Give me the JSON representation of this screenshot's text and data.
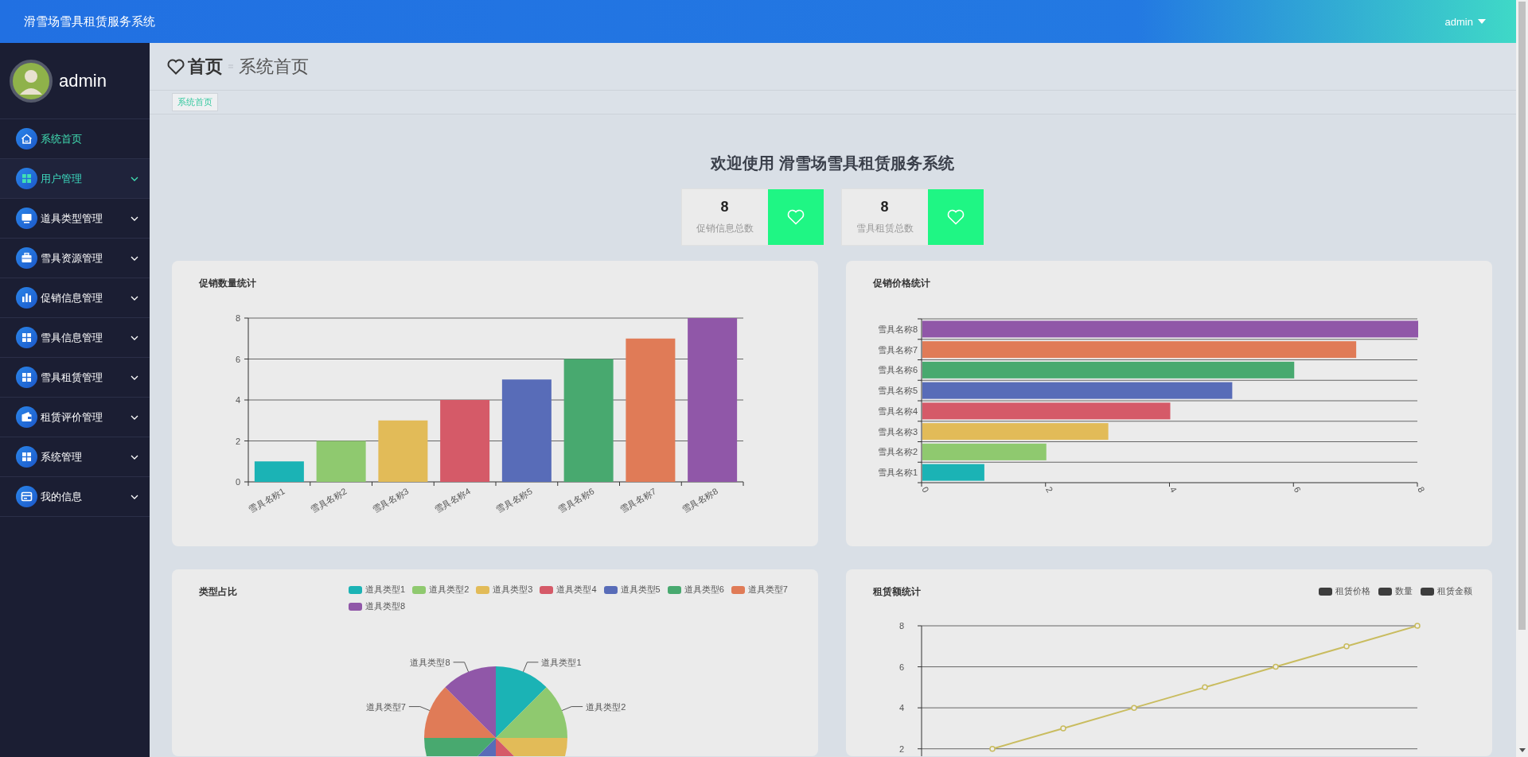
{
  "top_bar": {
    "title": "滑雪场雪具租赁服务系统",
    "user": "admin"
  },
  "sidebar": {
    "user": {
      "name": "admin"
    },
    "items": [
      {
        "label": "系统首页",
        "selected": true,
        "hovered": false,
        "expandable": false
      },
      {
        "label": "用户管理",
        "selected": false,
        "hovered": true,
        "expandable": true
      },
      {
        "label": "道具类型管理",
        "selected": false,
        "hovered": false,
        "expandable": true
      },
      {
        "label": "雪具资源管理",
        "selected": false,
        "hovered": false,
        "expandable": true
      },
      {
        "label": "促销信息管理",
        "selected": false,
        "hovered": false,
        "expandable": true
      },
      {
        "label": "雪具信息管理",
        "selected": false,
        "hovered": false,
        "expandable": true
      },
      {
        "label": "雪具租赁管理",
        "selected": false,
        "hovered": false,
        "expandable": true
      },
      {
        "label": "租赁评价管理",
        "selected": false,
        "hovered": false,
        "expandable": true
      },
      {
        "label": "系统管理",
        "selected": false,
        "hovered": false,
        "expandable": true
      },
      {
        "label": "我的信息",
        "selected": false,
        "hovered": false,
        "expandable": true
      }
    ]
  },
  "breadcrumb": {
    "title": "首页",
    "current": "系统首页"
  },
  "tabs": [
    {
      "label": "系统首页",
      "selected": true
    }
  ],
  "welcome": "欢迎使用 滑雪场雪具租赁服务系统",
  "stats": [
    {
      "value": "8",
      "label": "促销信息总数"
    },
    {
      "value": "8",
      "label": "雪具租赁总数"
    }
  ],
  "charts": [
    {
      "title": "促销数量统计",
      "chart_data": {
        "type": "bar",
        "categories": [
          "雪具名称1",
          "雪具名称2",
          "雪具名称3",
          "雪具名称4",
          "雪具名称5",
          "雪具名称6",
          "雪具名称7",
          "雪具名称8"
        ],
        "values": [
          1,
          2,
          3,
          4,
          5,
          6,
          7,
          8
        ],
        "colors": [
          "#1bb3b5",
          "#8fc96f",
          "#e2bb58",
          "#d55a68",
          "#586cb8",
          "#48a96f",
          "#e07b57",
          "#9057a8"
        ],
        "ylim": [
          0,
          8
        ],
        "yticks": [
          0,
          2,
          4,
          6,
          8
        ],
        "grid": true
      }
    },
    {
      "title": "促销价格统计",
      "chart_data": {
        "type": "bar",
        "orientation": "horizontal",
        "categories": [
          "雪具名称8",
          "雪具名称7",
          "雪具名称6",
          "雪具名称5",
          "雪具名称4",
          "雪具名称3",
          "雪具名称2",
          "雪具名称1"
        ],
        "values": [
          8,
          7,
          6,
          5,
          4,
          3,
          2,
          1
        ],
        "colors": [
          "#9057a8",
          "#e07b57",
          "#48a96f",
          "#586cb8",
          "#d55a68",
          "#e2bb58",
          "#8fc96f",
          "#1bb3b5"
        ],
        "xlim": [
          0,
          8
        ],
        "xticks": [
          0,
          2,
          4,
          6,
          8
        ],
        "grid": true
      }
    },
    {
      "title": "类型占比",
      "chart_data": {
        "type": "pie",
        "categories": [
          "道具类型1",
          "道具类型2",
          "道具类型3",
          "道具类型4",
          "道具类型5",
          "道具类型6",
          "道具类型7",
          "道具类型8"
        ],
        "values": [
          1,
          1,
          1,
          1,
          1,
          1,
          1,
          1
        ],
        "colors": [
          "#1bb3b5",
          "#8fc96f",
          "#e2bb58",
          "#d55a68",
          "#586cb8",
          "#48a96f",
          "#e07b57",
          "#9057a8"
        ]
      }
    },
    {
      "title": "租赁额统计",
      "legend": [
        "数量",
        "租赁金额"
      ],
      "chart_data": {
        "type": "line",
        "series": [
          {
            "name": "租赁价格",
            "values": [
              null,
              2,
              3,
              4,
              5,
              6,
              7,
              8
            ],
            "marker": true
          }
        ],
        "ylim": [
          1.64,
          8
        ],
        "yticks": [
          2,
          4,
          6,
          8
        ],
        "grid": true
      }
    }
  ]
}
